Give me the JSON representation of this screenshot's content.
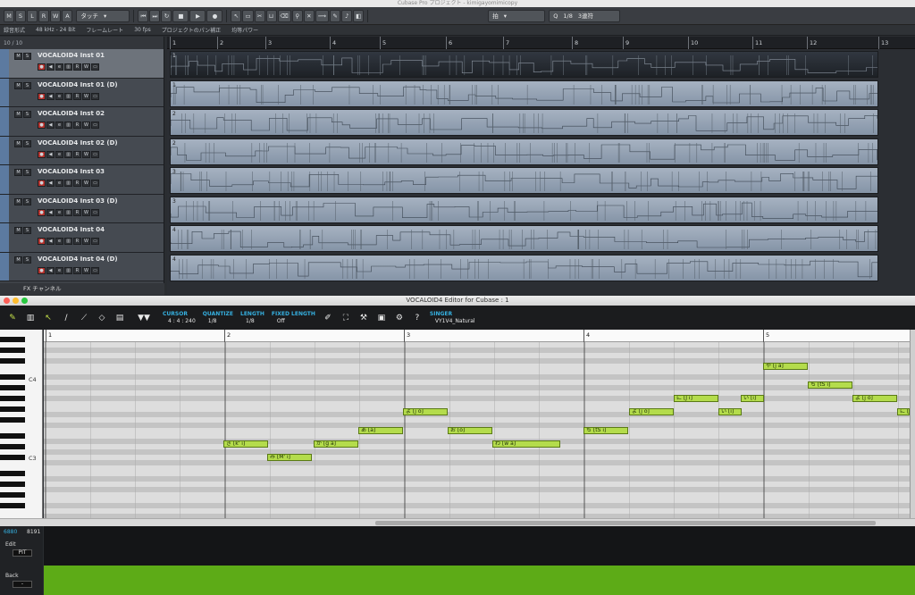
{
  "title_bar": {
    "text": "Cubase Pro プロジェクト - kimigayomimicopy"
  },
  "toolbar": {
    "buttons": [
      "M",
      "S",
      "L",
      "R",
      "W",
      "A"
    ],
    "automation_mode": "タッチ",
    "quantize": "1/8",
    "quantize_mode": "3連符",
    "snap_type": "拍"
  },
  "info_bar": {
    "items": [
      "録音形式",
      "48 kHz - 24 Bit",
      "フレームレート",
      "30 fps",
      "プロジェクトのパン補正",
      "均等パワー"
    ]
  },
  "tracklist": {
    "count": "10 / 10",
    "tracks": [
      {
        "name": "VOCALOID4 Inst 01",
        "selected": true
      },
      {
        "name": "VOCALOID4 Inst 01 (D)",
        "selected": false
      },
      {
        "name": "VOCALOID4 Inst 02",
        "selected": false
      },
      {
        "name": "VOCALOID4 Inst 02 (D)",
        "selected": false
      },
      {
        "name": "VOCALOID4 Inst 03",
        "selected": false
      },
      {
        "name": "VOCALOID4 Inst 03 (D)",
        "selected": false
      },
      {
        "name": "VOCALOID4 Inst 04",
        "selected": false
      },
      {
        "name": "VOCALOID4 Inst 04 (D)",
        "selected": false
      }
    ],
    "fx_channel": "FX チャンネル"
  },
  "arrange": {
    "bars": [
      "1",
      "2",
      "3",
      "4",
      "5",
      "6",
      "7",
      "8",
      "9",
      "10",
      "11",
      "12",
      "13"
    ],
    "lane_numbers": [
      "1",
      "1",
      "2",
      "2",
      "3",
      "3",
      "4",
      "4"
    ]
  },
  "editor": {
    "window_title": "VOCALOID4 Editor for Cubase : 1",
    "cursor_label": "CURSOR",
    "cursor_value": "4 : 4 : 240",
    "quantize_label": "QUANTIZE",
    "quantize_value": "1/8",
    "length_label": "LENGTH",
    "length_value": "1/8",
    "fixed_length_label": "FIXED LENGTH",
    "fixed_length_value": "Off",
    "singer_label": "SINGER",
    "singer_value": "VY1V4_Natural",
    "bars": [
      "1",
      "2",
      "3",
      "4",
      "5"
    ],
    "key_labels": [
      "C4",
      "C3"
    ],
    "notes": [
      {
        "lyric": "き [k' i]",
        "pos": 0
      },
      {
        "lyric": "み [M' i]",
        "pos": 1
      },
      {
        "lyric": "が [g a]",
        "pos": 2
      },
      {
        "lyric": "あ [a]",
        "pos": 3
      },
      {
        "lyric": "よ [j o]",
        "pos": 4
      },
      {
        "lyric": "お [o]",
        "pos": 5
      },
      {
        "lyric": "わ [w a]",
        "pos": 6
      },
      {
        "lyric": "ち [tS i]",
        "pos": 7
      },
      {
        "lyric": "よ [j o]",
        "pos": 8
      },
      {
        "lyric": "に [J i]",
        "pos": 9
      },
      {
        "lyric": "い [i]",
        "pos": 10
      },
      {
        "lyric": "い [i]",
        "pos": 11
      },
      {
        "lyric": "や [j a]",
        "pos": 12
      },
      {
        "lyric": "ち [tS i]",
        "pos": 13
      },
      {
        "lyric": "よ [j o]",
        "pos": 14
      },
      {
        "lyric": "に [J i]",
        "pos": 15
      }
    ]
  },
  "control_panel": {
    "value_a": "6880",
    "value_b": "8191",
    "edit_label": "Edit",
    "edit_param": "PIT",
    "back_label": "Back",
    "back_param": "-"
  }
}
